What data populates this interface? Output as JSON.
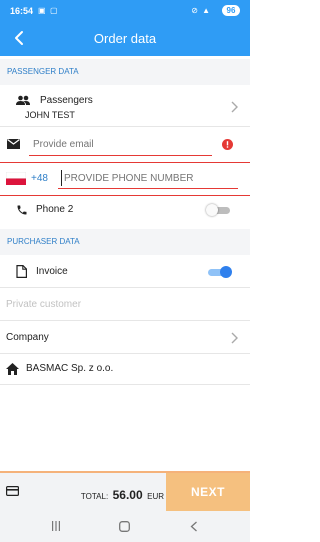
{
  "status_bar": {
    "time": "16:54",
    "battery": "96"
  },
  "header": {
    "title": "Order data"
  },
  "passenger_section": {
    "title": "PASSENGER DATA",
    "passengers_label": "Passengers",
    "passenger_name": "JOHN TEST",
    "email_placeholder": "Provide email",
    "phone_prefix": "+48",
    "phone_placeholder": "PROVIDE PHONE NUMBER",
    "phone2_label": "Phone 2"
  },
  "purchaser_section": {
    "title": "PURCHASER DATA",
    "invoice_label": "Invoice",
    "private_customer_label": "Private customer",
    "company_label": "Company",
    "company_name": "BASMAC Sp. z o.o."
  },
  "footer": {
    "total_label": "TOTAL:",
    "total_amount": "56.00",
    "currency": "EUR",
    "next_label": "NEXT"
  },
  "toggles": {
    "phone2_on": false,
    "invoice_on": true
  },
  "colors": {
    "accent": "#2f9cf5",
    "error": "#e53935",
    "next_button": "#f5c07f"
  },
  "icons": [
    "back-arrow-icon",
    "people-icon",
    "email-icon",
    "error-icon",
    "poland-flag-icon",
    "phone-icon",
    "document-icon",
    "house-icon",
    "payment-card-icon",
    "chevron-right-icon"
  ]
}
